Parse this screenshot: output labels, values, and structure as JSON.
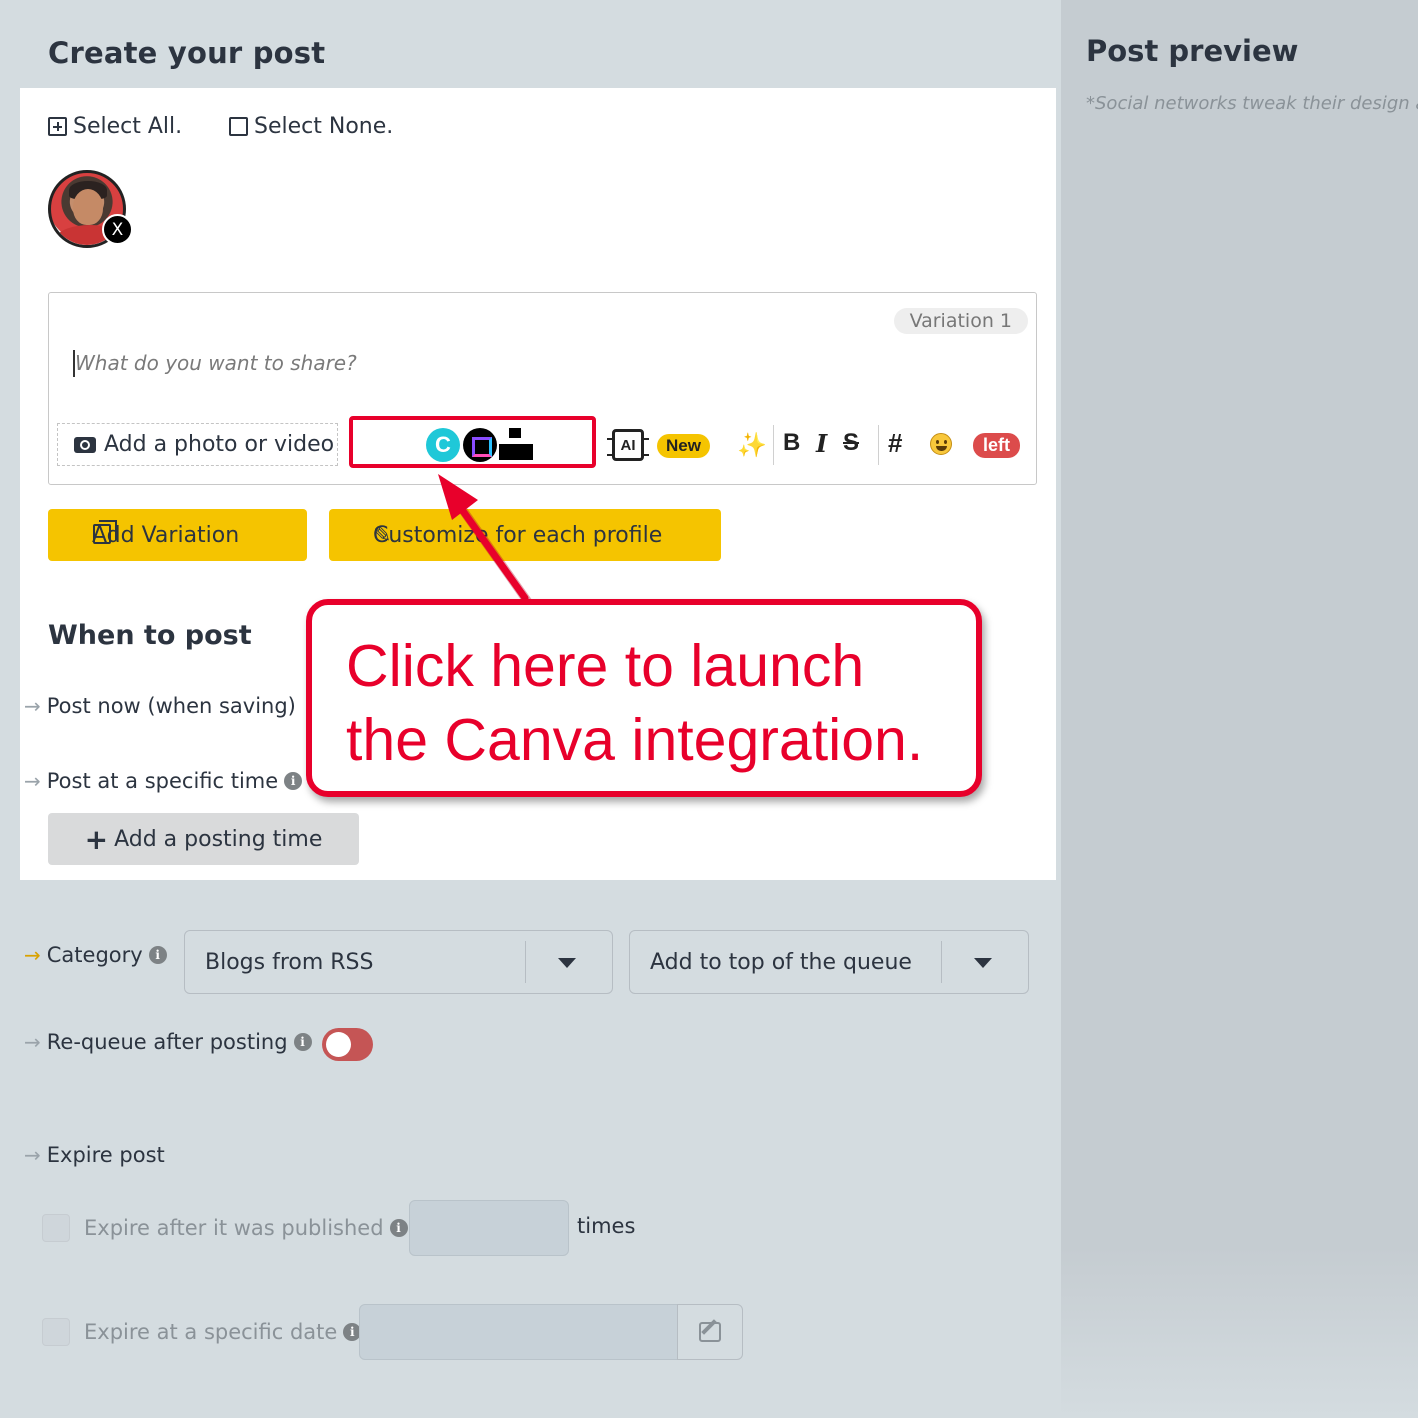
{
  "left": {
    "title": "Create your post",
    "select_all": "Select All.",
    "select_none": "Select None.",
    "avatar_badge": "X"
  },
  "editor": {
    "variation_label": "Variation 1",
    "placeholder": "What do you want to share?",
    "add_photo": "Add a photo or video",
    "canva_letter": "C",
    "ai_label": "AI",
    "new_badge": "New",
    "wand": "⁄",
    "bold": "B",
    "italic": "I",
    "strike": "S",
    "hash": "#",
    "left_badge": "left"
  },
  "buttons": {
    "add_variation": "Add Variation",
    "customize": "Customize for each profile"
  },
  "schedule": {
    "title": "When to post",
    "post_now": "Post now (when saving)",
    "post_specific": "Post at a specific time",
    "add_posting_time": "Add a posting time"
  },
  "category": {
    "label": "Category",
    "value": "Blogs from RSS",
    "queue_value": "Add to top of the queue"
  },
  "requeue": {
    "label": "Re-queue after posting",
    "enabled": false,
    "color": "#c55555"
  },
  "expire": {
    "label": "Expire post",
    "after_published": "Expire after it was published",
    "times": "times",
    "specific_date": "Expire at a specific date"
  },
  "preview": {
    "title": "Post preview",
    "note": "*Social networks tweak their design all t"
  },
  "callout": {
    "line1": "Click here to launch",
    "line2": "the Canva integration.",
    "color": "#e8002b"
  },
  "colors": {
    "accent_yellow": "#f5c400",
    "badge_red": "#dc4b4b",
    "annotation_red": "#e8002b"
  }
}
